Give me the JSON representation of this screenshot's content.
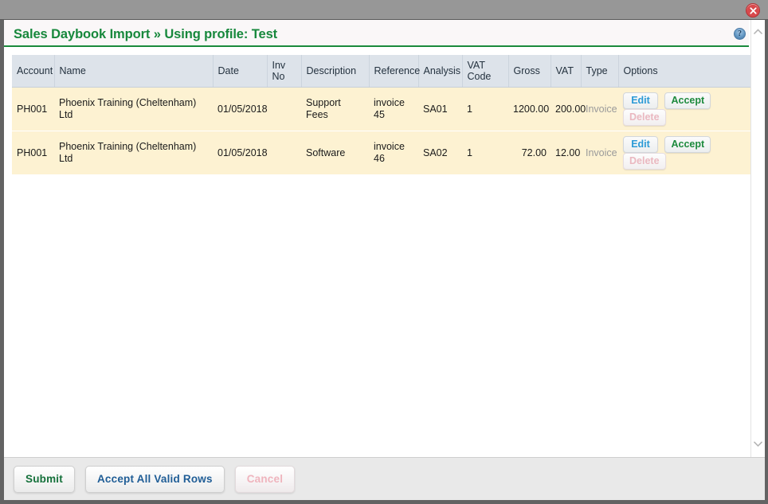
{
  "window": {
    "close_label": "×"
  },
  "header": {
    "title": "Sales Daybook Import » Using profile: Test",
    "help_glyph": "?",
    "accent_color": "#17883c"
  },
  "table": {
    "columns": [
      "Account",
      "Name",
      "Date",
      "Inv No",
      "Description",
      "Reference",
      "Analysis",
      "VAT Code",
      "Gross",
      "VAT",
      "Type",
      "Options"
    ],
    "rows": [
      {
        "account": "PH001",
        "name": "Phoenix Training (Cheltenham) Ltd",
        "date": "01/05/2018",
        "inv_no": "",
        "description": "Support Fees",
        "reference": "invoice 45",
        "analysis": "SA01",
        "vat_code": "1",
        "gross": "1200.00",
        "vat": "200.00",
        "type": "Invoice",
        "options": {
          "edit": "Edit",
          "accept": "Accept",
          "delete": "Delete"
        }
      },
      {
        "account": "PH001",
        "name": "Phoenix Training (Cheltenham) Ltd",
        "date": "01/05/2018",
        "inv_no": "",
        "description": "Software",
        "reference": "invoice 46",
        "analysis": "SA02",
        "vat_code": "1",
        "gross": "72.00",
        "vat": "12.00",
        "type": "Invoice",
        "options": {
          "edit": "Edit",
          "accept": "Accept",
          "delete": "Delete"
        }
      }
    ],
    "row_bg_color": "#fdf2d2",
    "header_bg_color": "#dde3ea"
  },
  "footer": {
    "submit_label": "Submit",
    "accept_all_label": "Accept All Valid Rows",
    "cancel_label": "Cancel",
    "submit_color": "#14703a",
    "accept_all_color": "#1f5d96",
    "cancel_color": "#efb4bd"
  }
}
